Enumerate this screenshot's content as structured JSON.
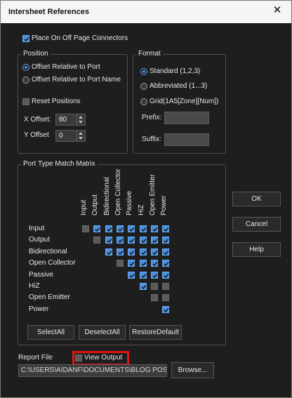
{
  "window": {
    "title": "Intersheet References",
    "close_glyph": "✕"
  },
  "place_connectors": {
    "label": "Place On Off Page Connectors",
    "checked": true
  },
  "position": {
    "title": "Position",
    "offset_port": "Offset Relative to Port",
    "offset_port_name": "Offset Relative to Port Name",
    "reset_positions": "Reset Positions",
    "x_offset_label": "X Offset:",
    "x_offset_value": "80",
    "y_offset_label": "Y Offset",
    "y_offset_value": "0"
  },
  "format": {
    "title": "Format",
    "standard": "Standard (1,2,3)",
    "abbreviated": "Abbreviated (1...3)",
    "grid": "Grid(1A5[Zone][Num])",
    "prefix_label": "Prefix:",
    "suffix_label": "Suffix:"
  },
  "matrix": {
    "title": "Port Type Match Matrix",
    "columns": [
      "Input",
      "Output",
      "Bidirectional",
      "Open Collector",
      "Passive",
      "HiZ",
      "Open Emitter",
      "Power"
    ],
    "rows": [
      {
        "label": "Input",
        "cells": [
          "off",
          "on",
          "on",
          "on",
          "on",
          "on",
          "on",
          "on"
        ]
      },
      {
        "label": "Output",
        "cells": [
          "",
          "off",
          "on",
          "on",
          "on",
          "on",
          "on",
          "on"
        ]
      },
      {
        "label": "Bidirectional",
        "cells": [
          "",
          "",
          "on",
          "on",
          "on",
          "on",
          "on",
          "on"
        ]
      },
      {
        "label": "Open Collector",
        "cells": [
          "",
          "",
          "",
          "off",
          "on",
          "on",
          "on",
          "on"
        ]
      },
      {
        "label": "Passive",
        "cells": [
          "",
          "",
          "",
          "",
          "on",
          "on",
          "on",
          "on"
        ]
      },
      {
        "label": "HiZ",
        "cells": [
          "",
          "",
          "",
          "",
          "",
          "on",
          "off",
          "off"
        ]
      },
      {
        "label": "Open Emitter",
        "cells": [
          "",
          "",
          "",
          "",
          "",
          "",
          "off",
          "off"
        ]
      },
      {
        "label": "Power",
        "cells": [
          "",
          "",
          "",
          "",
          "",
          "",
          "",
          "on"
        ]
      }
    ],
    "select_all": "SelectAll",
    "deselect_all": "DeselectAll",
    "restore_default": "RestoreDefault"
  },
  "buttons": {
    "ok": "OK",
    "cancel": "Cancel",
    "help": "Help",
    "browse": "Browse..."
  },
  "report": {
    "label": "Report File",
    "view_output": "View Output",
    "path": "C:\\USERS\\AIDANF\\DOCUMENTS\\BLOG POS"
  },
  "colors": {
    "accent": "#4a90e2",
    "highlight": "#e01515",
    "background": "#1e1e1e"
  }
}
